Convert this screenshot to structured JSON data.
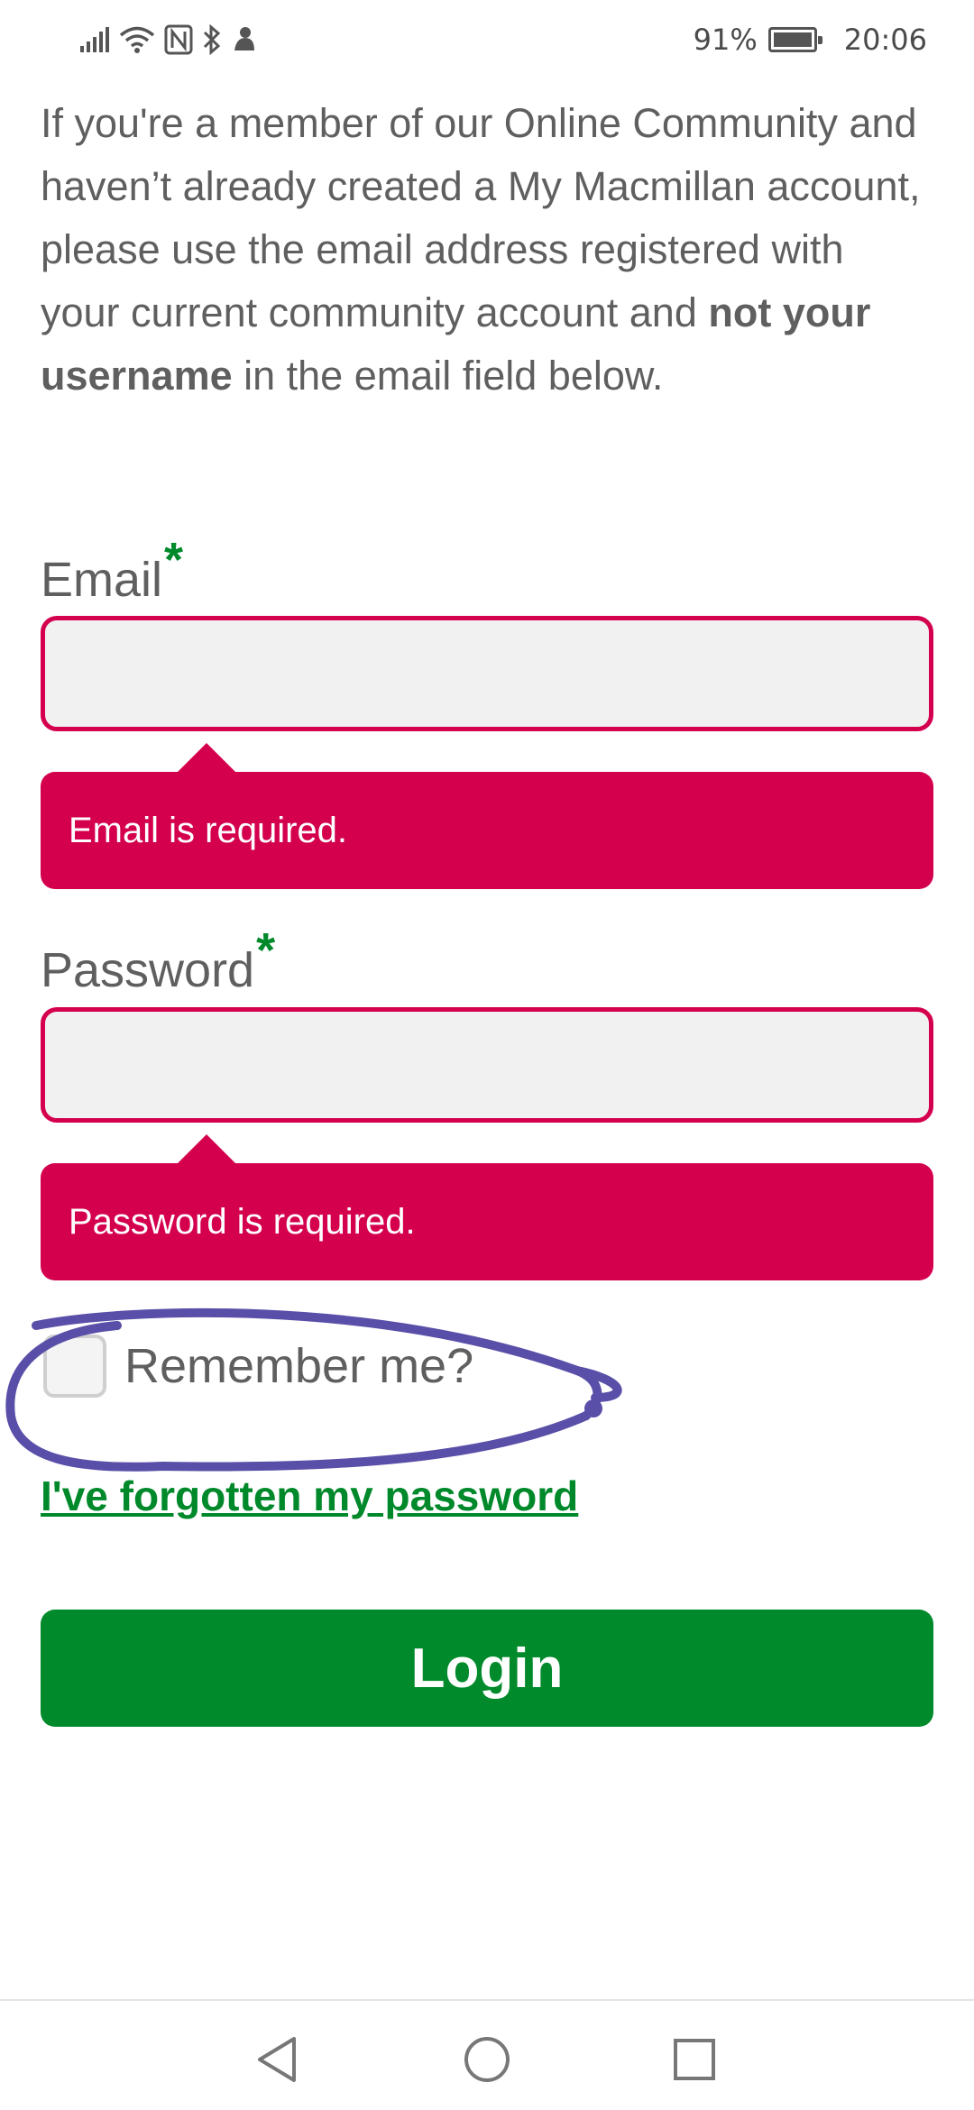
{
  "status_bar": {
    "battery_percent": "91%",
    "time": "20:06",
    "icons": [
      "signal-icon",
      "wifi-icon",
      "nfc-icon",
      "bluetooth-icon",
      "notification-icon",
      "battery-icon"
    ]
  },
  "intro": {
    "text_before": "If you're a member of our Online Community and haven’t already created a My Macmillan account, please use the email address registered with your current community account and ",
    "bold_text": "not your username",
    "text_after": " in the email field below."
  },
  "email": {
    "label": "Email",
    "required_marker": "*",
    "value": "",
    "error": "Email is required."
  },
  "password": {
    "label": "Password",
    "required_marker": "*",
    "value": "",
    "error": "Password is required."
  },
  "remember": {
    "label": "Remember me?",
    "checked": false
  },
  "forgot_link": "I've forgotten my password",
  "login_button": "Login",
  "colors": {
    "error": "#d4004e",
    "accent_green": "#00892a",
    "annotation": "#5a4fa8"
  },
  "nav": {
    "icons": [
      "back-icon",
      "home-icon",
      "recents-icon"
    ]
  }
}
